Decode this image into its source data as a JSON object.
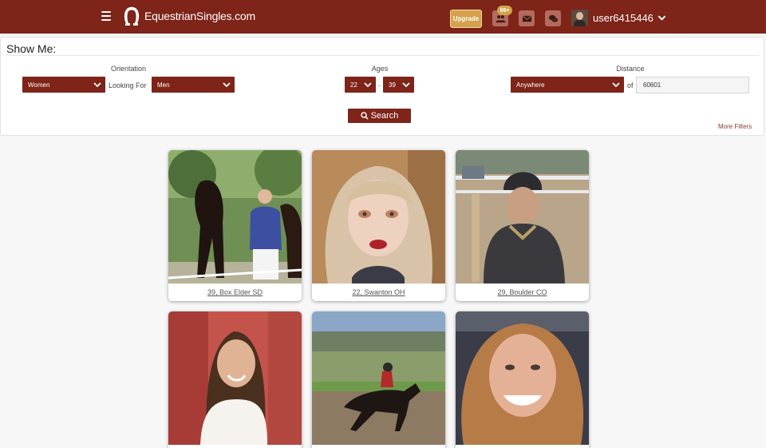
{
  "header": {
    "site_name": "EquestrianSingles.com",
    "upgrade_label": "Upgrade",
    "notification_badge": "99+",
    "username": "user6415446",
    "icons": [
      "menu-icon",
      "horseshoe-logo-icon",
      "friends-icon",
      "mail-icon",
      "chat-icon",
      "chevron-down-icon"
    ]
  },
  "filters": {
    "title": "Show Me:",
    "orientation_label": "Orientation",
    "seeking_value": "Women",
    "looking_for_label": "Looking For",
    "self_value": "Men",
    "ages_label": "Ages",
    "age_min": "22",
    "age_separator": "-",
    "age_max": "39",
    "distance_label": "Distance",
    "distance_value": "Anywhere",
    "of_label": "of",
    "zip_value": "60601",
    "search_label": "Search",
    "more_filters_label": "More Filters"
  },
  "profiles": [
    {
      "caption": "39, Box Elder SD"
    },
    {
      "caption": "22, Swanton OH"
    },
    {
      "caption": "29, Boulder CO"
    },
    {
      "caption": ""
    },
    {
      "caption": ""
    },
    {
      "caption": ""
    }
  ],
  "colors": {
    "brand": "#7e2418",
    "accent": "#d4a24c"
  }
}
